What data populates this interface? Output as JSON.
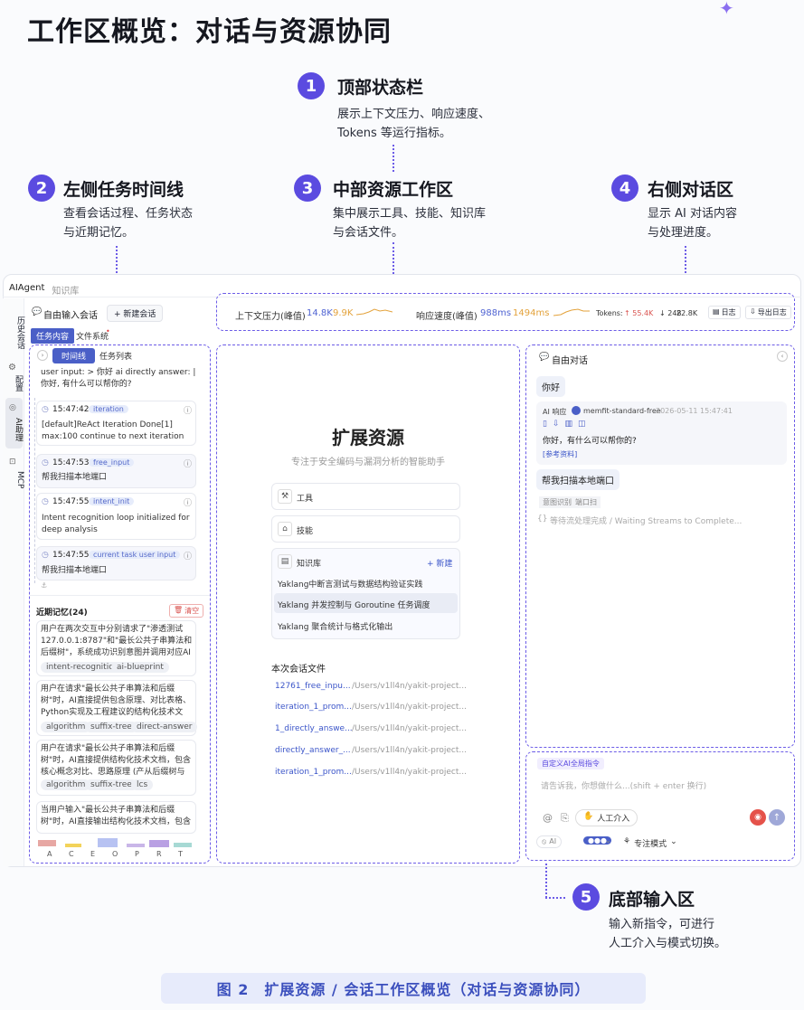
{
  "page_title": "工作区概览：对话与资源协同",
  "annotations": [
    {
      "num": "1",
      "title": "顶部状态栏",
      "desc1": "展示上下文压力、响应速度、",
      "desc2": "Tokens 等运行指标。"
    },
    {
      "num": "2",
      "title": "左侧任务时间线",
      "desc1": "查看会话过程、任务状态",
      "desc2": "与近期记忆。"
    },
    {
      "num": "3",
      "title": "中部资源工作区",
      "desc1": "集中展示工具、技能、知识库",
      "desc2": "与会话文件。"
    },
    {
      "num": "4",
      "title": "右侧对话区",
      "desc1": "显示 AI 对话内容",
      "desc2": "与处理进度。"
    },
    {
      "num": "5",
      "title": "底部输入区",
      "desc1": "输入新指令，可进行",
      "desc2": "人工介入与模式切换。"
    }
  ],
  "app": {
    "tabs": [
      "AIAgent",
      "知识库"
    ],
    "rail": [
      "历史会话",
      "配置",
      "AI助理",
      "MCP"
    ],
    "session": {
      "free_input": "自由输入会话",
      "new_session": "+ 新建会话"
    },
    "status": {
      "ctx_label": "上下文压力(峰值)",
      "ctx_val1": "14.8K",
      "ctx_val2": "9.9K",
      "speed_label": "响应速度(峰值)",
      "speed_val1": "988ms",
      "speed_val2": "1494ms",
      "tokens_label": "Tokens:",
      "tokens_up": "↑ 55.4K",
      "tokens_down": "↓ 248",
      "tokens_total": "22.8K",
      "log_btn": "日志",
      "export_btn": "导出日志"
    },
    "left_tabs": [
      "任务内容",
      "文件系统"
    ],
    "sub_tabs": [
      "时间线",
      "任务列表"
    ],
    "timeline_top": "user input: > 你好 ai directly answer: | 你好, 有什么可以帮你的?",
    "timeline": [
      {
        "time": "15:47:42",
        "tag": "iteration",
        "text": "[default]ReAct Iteration Done[1] max:100 continue to next iteration"
      },
      {
        "time": "15:47:53",
        "tag": "free_input",
        "text": "帮我扫描本地端口"
      },
      {
        "time": "15:47:55",
        "tag": "intent_init",
        "text": "Intent recognition loop initialized for deep analysis"
      },
      {
        "time": "15:47:55",
        "tag": "current task user input",
        "text": "帮我扫描本地端口"
      }
    ],
    "memory_title": "近期记忆(24)",
    "memory_clear": "清空",
    "memories": [
      {
        "text": "用户在两次交互中分别请求了\"渗透测试127.0.0.1:8787\"和\"最长公共子串算法和后缀树\"，系统成功识别意图并调用对应AI链...",
        "tags": [
          "intent-recognition",
          "ai-blueprint"
        ]
      },
      {
        "text": "用户在请求\"最长公共子串算法和后缀树\"时，AI直接提供包含原理、对比表格、Python实现及工程建议的结构化技术文档。用户未提出修...",
        "tags": [
          "algorithm",
          "suffix-tree",
          "direct-answer"
        ]
      },
      {
        "text": "用户在请求\"最长公共子串算法和后缀树\"时，AI直接提供结构化技术文档，包含核心概念对比、思路原理 (产从后缀树与后缀数组...",
        "tags": [
          "algorithm",
          "suffix-tree",
          "lcs"
        ]
      },
      {
        "text": "当用户输入\"最长公共子串算法和后缀树\"时，AI直接输出结构化技术文档，包含核心概念对",
        "tags": []
      }
    ],
    "legend_letters": [
      "A",
      "C",
      "E",
      "O",
      "P",
      "R",
      "T"
    ],
    "center": {
      "title": "扩展资源",
      "subtitle": "专注于安全编码与漏洞分析的智能助手",
      "tools": "工具",
      "skills": "技能",
      "kb": "知识库",
      "kb_new": "+ 新建",
      "kb_items": [
        "Yaklang中断言测试与数据结构验证实践",
        "Yaklang 并发控制与 Goroutine 任务调度",
        "Yaklang 聚合统计与格式化输出"
      ],
      "files_title": "本次会话文件",
      "files": [
        {
          "name": "12761_free_inpu...",
          "path": "/Users/v1ll4n/yakit-project..."
        },
        {
          "name": "iteration_1_prom...",
          "path": "/Users/v1ll4n/yakit-project..."
        },
        {
          "name": "1_directly_answe...",
          "path": "/Users/v1ll4n/yakit-project..."
        },
        {
          "name": "directly_answer_...",
          "path": "/Users/v1ll4n/yakit-project..."
        },
        {
          "name": "iteration_1_prom...",
          "path": "/Users/v1ll4n/yakit-project..."
        }
      ]
    },
    "chat": {
      "title": "自由对话",
      "user1": "你好",
      "ai_label": "AI 响应",
      "model": "memfit-standard-free",
      "ai_time": "2026-05-11 15:47:41",
      "ai_text": "你好，有什么可以帮你的?",
      "ref": "[参考资料]",
      "user2": "帮我扫描本地端口",
      "intent_label": "意图识别",
      "intent_val": "端口扫",
      "waiting": "等待流处理完成 / Waiting Streams to Complete..."
    },
    "input": {
      "custom_cmd": "自定义AI全局指令",
      "placeholder": "请告诉我，你想做什么...(shift + enter 换行)",
      "manual": "人工介入",
      "mode": "专注模式",
      "ai_label": "AI"
    }
  },
  "caption": "图 2　扩展资源 / 会话工作区概览（对话与资源协同）"
}
